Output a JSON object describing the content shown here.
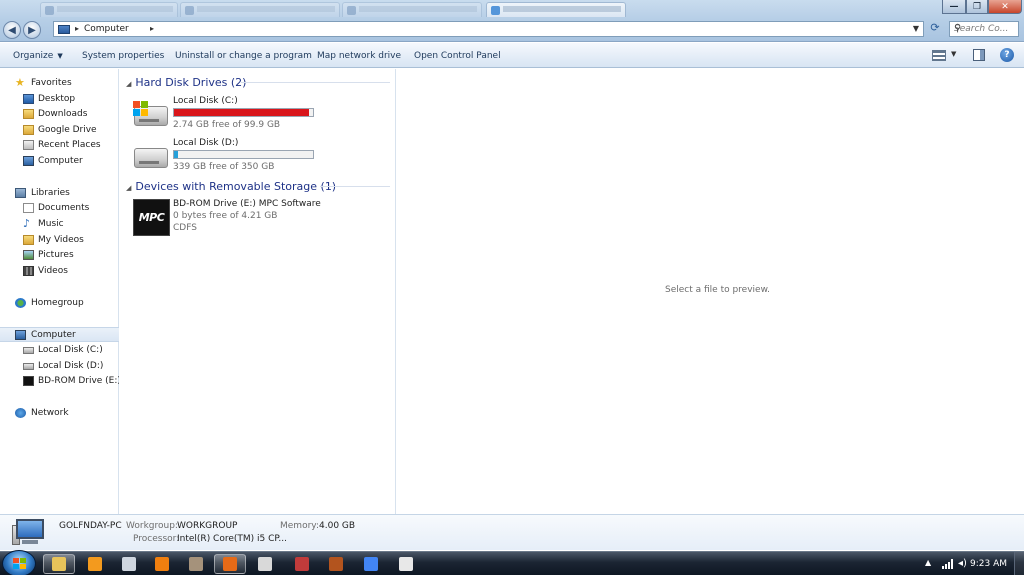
{
  "window": {
    "address": {
      "crumb": "Computer"
    },
    "search": {
      "placeholder": "Search Co..."
    },
    "controls": {
      "minimize": "—",
      "maximize": "❐",
      "close": "✕"
    }
  },
  "toolbar": {
    "organize": "Organize",
    "system_properties": "System properties",
    "uninstall": "Uninstall or change a program",
    "map_drive": "Map network drive",
    "control_panel": "Open Control Panel"
  },
  "nav": {
    "favorites": "Favorites",
    "desktop": "Desktop",
    "downloads": "Downloads",
    "google_drive": "Google Drive",
    "recent_places": "Recent Places",
    "computer_fav": "Computer",
    "libraries": "Libraries",
    "documents": "Documents",
    "music": "Music",
    "my_videos": "My Videos",
    "pictures": "Pictures",
    "videos": "Videos",
    "homegroup": "Homegroup",
    "computer": "Computer",
    "local_c": "Local Disk (C:)",
    "local_d": "Local Disk (D:)",
    "bdrom": "BD-ROM Drive (E:) MPC Software",
    "network": "Network"
  },
  "content": {
    "hdd_header": "Hard Disk Drives (2)",
    "removable_header": "Devices with Removable Storage (1)",
    "drives": [
      {
        "name": "Local Disk (C:)",
        "free": "2.74 GB free of 99.9 GB",
        "used_fraction": 0.973,
        "bar_color": "#d9151b"
      },
      {
        "name": "Local Disk (D:)",
        "free": "339 GB free of 350 GB",
        "used_fraction": 0.031,
        "bar_color": "#26a0da"
      }
    ],
    "removable": {
      "name": "BD-ROM Drive (E:) MPC Software",
      "free": "0 bytes free of 4.21 GB",
      "fs": "CDFS",
      "logo_text": "MPC"
    }
  },
  "preview": {
    "message": "Select a file to preview."
  },
  "details": {
    "computer_name": "GOLFNDAY-PC",
    "workgroup_label": "Workgroup:",
    "workgroup": "WORKGROUP",
    "memory_label": "Memory:",
    "memory": "4.00 GB",
    "processor_label": "Processor:",
    "processor": "Intel(R) Core(TM) i5 CP..."
  },
  "taskbar": {
    "clock": "9:23 AM",
    "apps": [
      {
        "name": "explorer",
        "color": "#e7c35a",
        "active": true
      },
      {
        "name": "media-player",
        "color": "#f39a1e",
        "active": false
      },
      {
        "name": "pointer-app",
        "color": "#cfd6df",
        "active": false
      },
      {
        "name": "illustrator",
        "color": "#f07f0f",
        "active": false
      },
      {
        "name": "gimp",
        "color": "#a5927b",
        "active": false
      },
      {
        "name": "firefox",
        "color": "#e66a17",
        "active": true
      },
      {
        "name": "app-7",
        "color": "#d9d9d9",
        "active": false
      },
      {
        "name": "app-8",
        "color": "#c13b3b",
        "active": false
      },
      {
        "name": "app-9",
        "color": "#b3541e",
        "active": false
      },
      {
        "name": "chrome",
        "color": "#4285f4",
        "active": false
      },
      {
        "name": "calculator",
        "color": "#e8e8e8",
        "active": false
      }
    ]
  }
}
